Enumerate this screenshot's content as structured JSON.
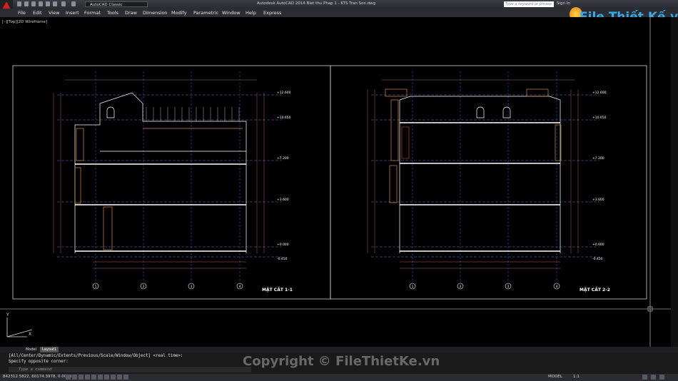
{
  "title": {
    "workspace": "AutoCAD Classic",
    "window_title": "Autodesk AutoCAD 2014    Biet thu Phap 1 - KTS Tran Son.dwg",
    "search_placeholder": "Type a keyword or phrase",
    "sign_in": "Sign In"
  },
  "menu": [
    "File",
    "Edit",
    "View",
    "Insert",
    "Format",
    "Tools",
    "Draw",
    "Dimension",
    "Modify",
    "Parametric",
    "Window",
    "Help",
    "Express"
  ],
  "viewport_label": "[–][Top][2D Wireframe]",
  "drawing": {
    "left_section_title": "MẶT CẮT 1-1",
    "right_section_title": "MẶT CẮT 2-2",
    "grid_labels": [
      "1",
      "2",
      "3",
      "4"
    ],
    "level_marks": [
      "+12.600",
      "+10.650",
      "+7.200",
      "+3.600",
      "+0.000",
      "-0.450"
    ]
  },
  "ucs": {
    "x": "X",
    "y": "Y"
  },
  "tabs": [
    "Model",
    "Layout1"
  ],
  "command": {
    "line1": "[All/Center/Dynamic/Extents/Previous/Scale/Window/Object] <real time>:",
    "line2": "Specify opposite corner:",
    "placeholder": "Type a command"
  },
  "status": {
    "coords": "842312.5822, 60174.3978, 0.0000",
    "space": "MODEL",
    "scale": "1:1"
  },
  "watermark": "Copyright © FileThietKe.vn",
  "logo": "File Thiết Kế.vn",
  "colors": {
    "accent": "#d42020",
    "dim": "#e07a7a",
    "grid": "#3a5fd9",
    "line": "#ffffff",
    "level": "#e6e6e6"
  }
}
